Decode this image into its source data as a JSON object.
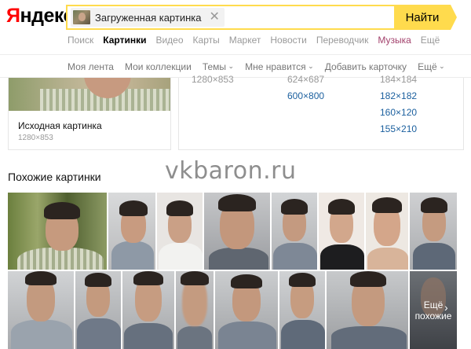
{
  "header": {
    "logo_first": "Я",
    "logo_rest": "ндекс",
    "search_chip_label": "Загруженная картинка",
    "search_button": "Найти"
  },
  "services": [
    "Поиск",
    "Картинки",
    "Видео",
    "Карты",
    "Маркет",
    "Новости",
    "Переводчик",
    "Музыка",
    "Ещё"
  ],
  "active_service": "Картинки",
  "subnav": [
    {
      "label": "Моя лента",
      "dropdown": false
    },
    {
      "label": "Мои коллекции",
      "dropdown": false
    },
    {
      "label": "Темы",
      "dropdown": true
    },
    {
      "label": "Мне нравится",
      "dropdown": true
    },
    {
      "label": "Добавить карточку",
      "dropdown": false
    },
    {
      "label": "Ещё",
      "dropdown": true
    }
  ],
  "source": {
    "title": "Исходная картинка",
    "size": "1280×853"
  },
  "sizes": {
    "col1": [
      "1280×853"
    ],
    "col2": [
      "624×687",
      "600×800"
    ],
    "col3": [
      "184×184",
      "182×182",
      "160×120",
      "155×210"
    ]
  },
  "watermark": "vkbaron.ru",
  "similar": {
    "title": "Похожие картинки",
    "more_label_line1": "Ещё",
    "more_label_line2": "похожие"
  }
}
